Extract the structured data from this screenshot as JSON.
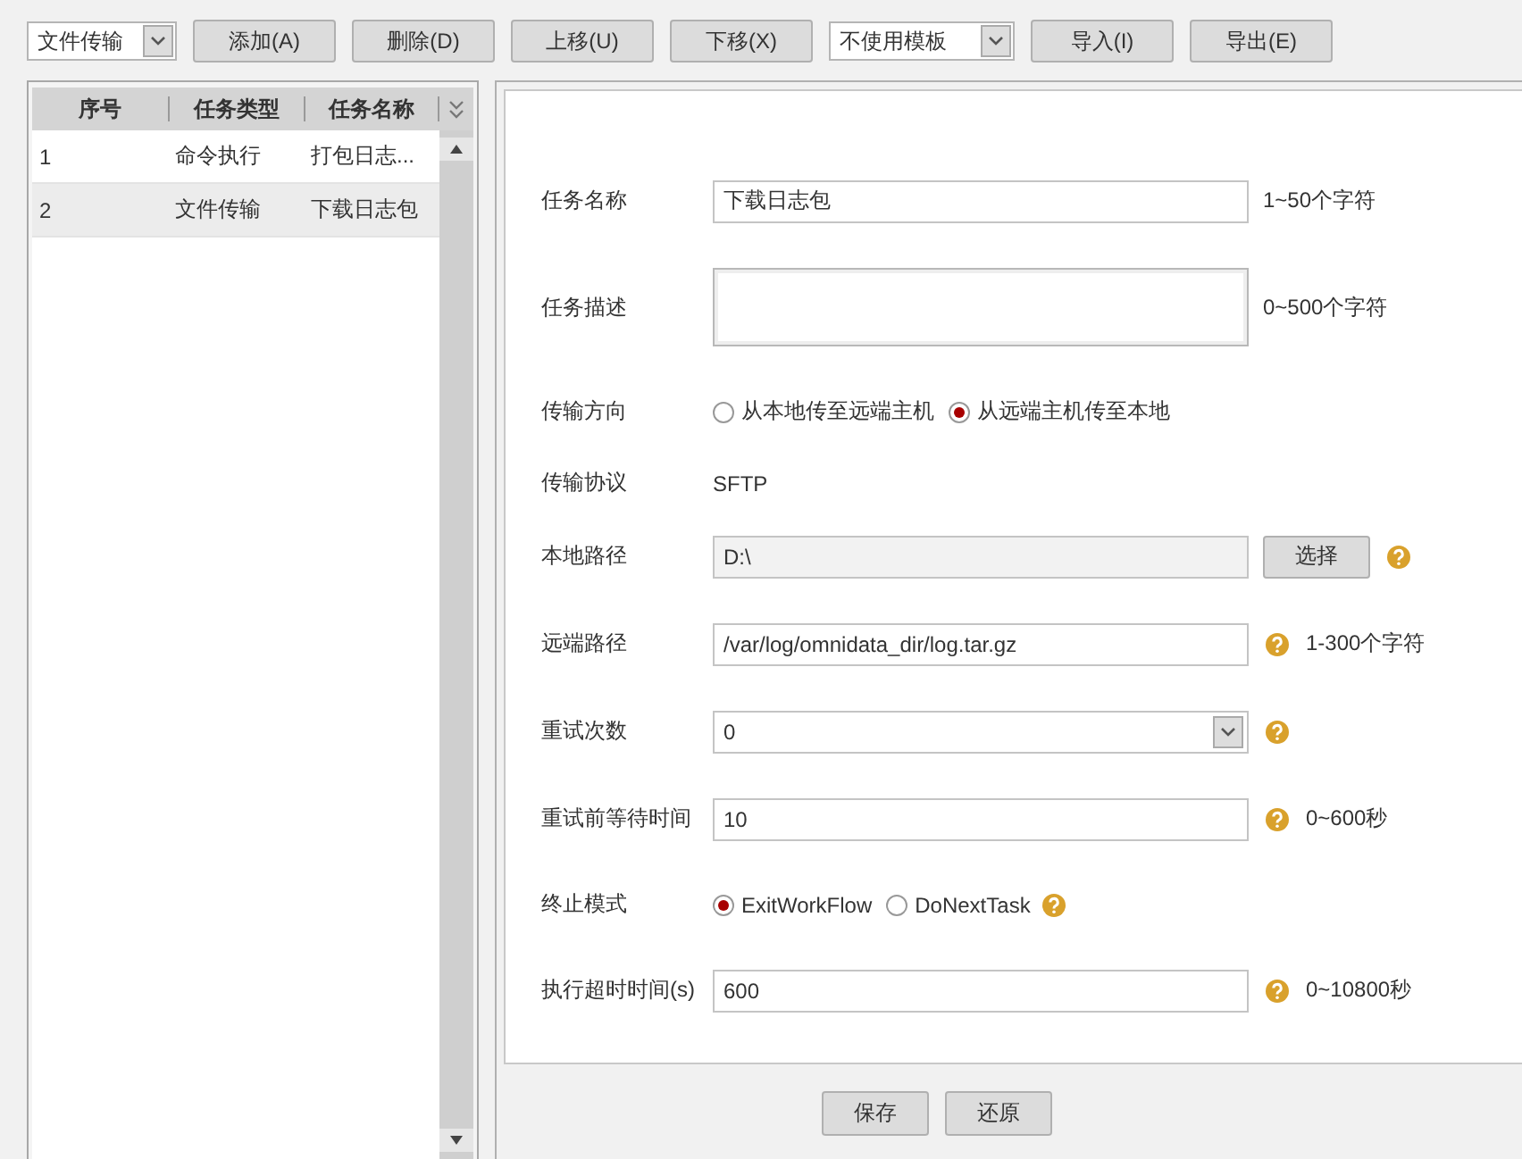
{
  "toolbar": [
    {
      "kind": "select",
      "value": "文件传输"
    },
    {
      "kind": "button",
      "label": "添加(A)"
    },
    {
      "kind": "button",
      "label": "删除(D)"
    },
    {
      "kind": "button",
      "label": "上移(U)"
    },
    {
      "kind": "button",
      "label": "下移(X)"
    },
    {
      "kind": "select",
      "value": "不使用模板"
    },
    {
      "kind": "button",
      "label": "导入(I)"
    },
    {
      "kind": "button",
      "label": "导出(E)"
    }
  ],
  "task_list": {
    "columns": [
      "序号",
      "任务类型",
      "任务名称"
    ],
    "rows": [
      {
        "cells": [
          "1",
          "命令执行",
          "打包日志..."
        ],
        "selected": false
      },
      {
        "cells": [
          "2",
          "文件传输",
          "下载日志包"
        ],
        "selected": true
      }
    ]
  },
  "form": {
    "fields": [
      {
        "kind": "text",
        "label": "任务名称",
        "value": "下载日志包",
        "help": false,
        "hint": "1~50个字符"
      },
      {
        "kind": "textarea",
        "label": "任务描述",
        "help": false,
        "hint": "0~500个字符"
      },
      {
        "kind": "radio",
        "label": "传输方向",
        "help": false,
        "options": [
          {
            "label": "从本地传至远端主机",
            "selected": false
          },
          {
            "label": "从远端主机传至本地",
            "selected": true
          }
        ]
      },
      {
        "kind": "static",
        "label": "传输协议",
        "value": "SFTP",
        "help": false
      },
      {
        "kind": "text",
        "label": "本地路径",
        "value": "D:\\",
        "disabled": true,
        "button": "选择",
        "help": true
      },
      {
        "kind": "text",
        "label": "远端路径",
        "value": "/var/log/omnidata_dir/log.tar.gz",
        "help": true,
        "hint": "1-300个字符"
      },
      {
        "kind": "select",
        "label": "重试次数",
        "value": "0",
        "help": true
      },
      {
        "kind": "text",
        "label": "重试前等待时间",
        "value": "10",
        "help": true,
        "hint": "0~600秒"
      },
      {
        "kind": "radio",
        "label": "终止模式",
        "help": true,
        "options": [
          {
            "label": "ExitWorkFlow",
            "selected": true
          },
          {
            "label": "DoNextTask",
            "selected": false
          }
        ]
      },
      {
        "kind": "text",
        "label": "执行超时时间(s)",
        "value": "600",
        "help": true,
        "hint": "0~10800秒"
      }
    ]
  },
  "footer_buttons": [
    "保存",
    "还原"
  ]
}
